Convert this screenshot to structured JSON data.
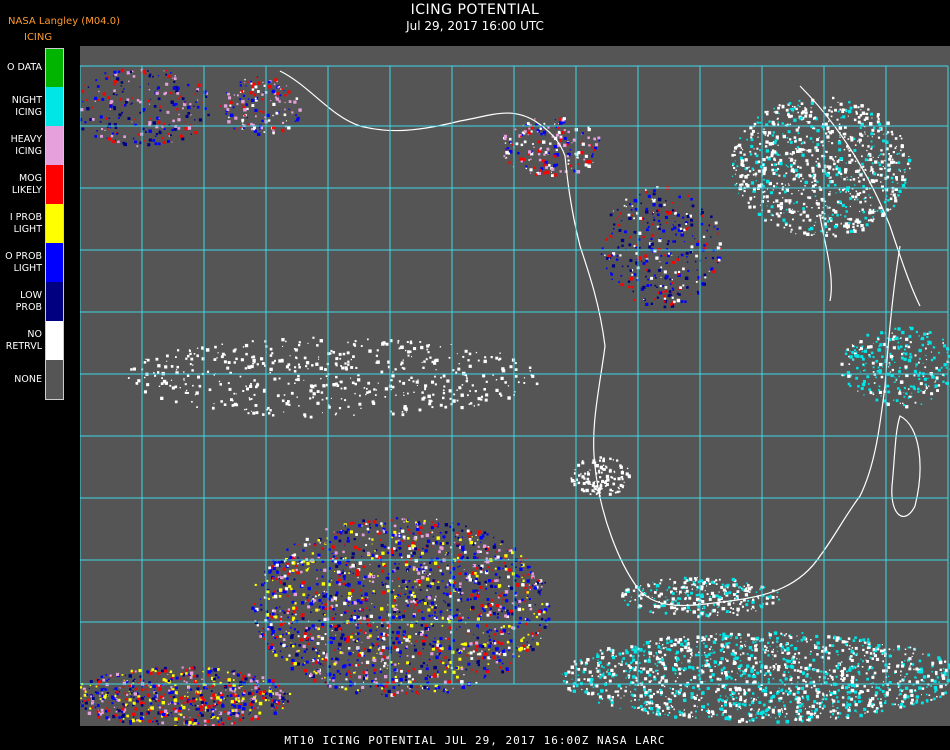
{
  "header": {
    "source": "NASA Langley (M04.0)",
    "product": "ICING",
    "title": "ICING POTENTIAL",
    "datetime": "Jul 29, 2017 16:00 UTC"
  },
  "legend": [
    {
      "label": "O DATA",
      "color": "#00b400"
    },
    {
      "label": "NIGHT\nICING",
      "color": "#00e6e6"
    },
    {
      "label": "HEAVY\nICING",
      "color": "#e6a0dc"
    },
    {
      "label": "MOG\nLIKELY",
      "color": "#ff0000"
    },
    {
      "label": "I PROB\nLIGHT",
      "color": "#ffff00"
    },
    {
      "label": "O PROB\nLIGHT",
      "color": "#0000ff"
    },
    {
      "label": "LOW\nPROB",
      "color": "#000080"
    },
    {
      "label": "NO\nRETRVL",
      "color": "#ffffff"
    },
    {
      "label": "NONE",
      "color": "#555555"
    }
  ],
  "map": {
    "background_color": "#555555",
    "grid_color": "#3fd8e6",
    "coast_color": "#ffffff",
    "grid_label_color": "#cc2222"
  },
  "footer": "MT10  ICING POTENTIAL   JUL 29, 2017 16:00Z   NASA LARC"
}
